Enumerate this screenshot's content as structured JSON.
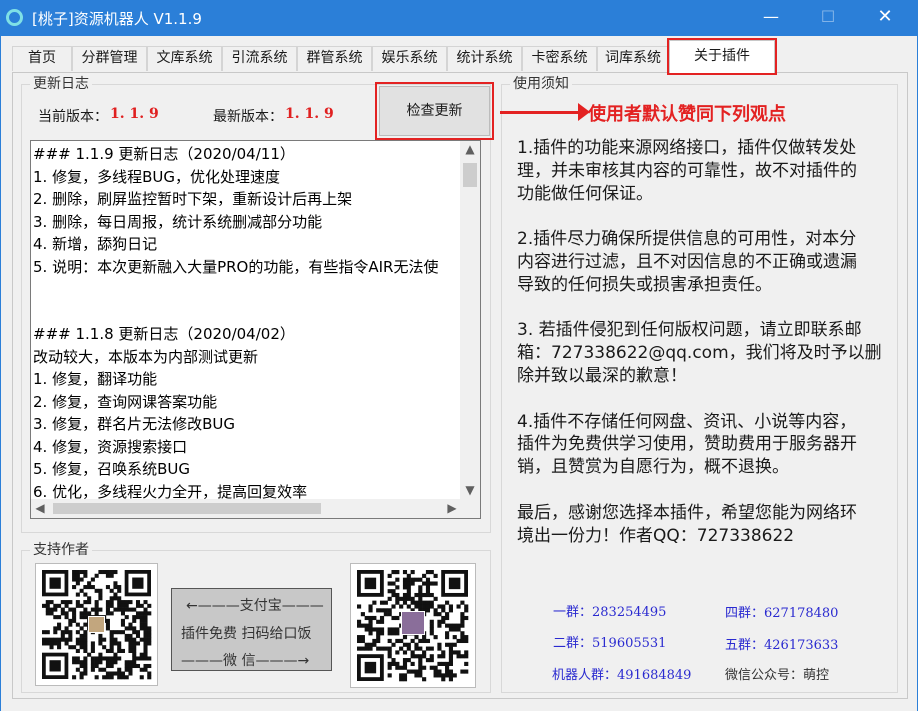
{
  "window": {
    "title": "[桃子]资源机器人 V1.1.9",
    "minimize_glyph": "—",
    "maximize_glyph": "☐",
    "close_glyph": "✕"
  },
  "tabs": [
    "首页",
    "分群管理",
    "文库系统",
    "引流系统",
    "群管系统",
    "娱乐系统",
    "统计系统",
    "卡密系统",
    "词库系统",
    "关于插件"
  ],
  "active_tab": "关于插件",
  "update_log": {
    "group_title": "更新日志",
    "current_label": "当前版本：",
    "current_version": "1. 1. 9",
    "latest_label": "最新版本：",
    "latest_version": "1. 1. 9",
    "check_button": "检查更新",
    "lines": [
      "### 1.1.9 更新日志（2020/04/11）",
      "1. 修复，多线程BUG，优化处理速度",
      "2. 删除，刷屏监控暂时下架，重新设计后再上架",
      "3. 删除，每日周报，统计系统删减部分功能",
      "4. 新增，舔狗日记",
      "5. 说明：本次更新融入大量PRO的功能，有些指令AIR无法使",
      "",
      "",
      "### 1.1.8 更新日志（2020/04/02）",
      "改动较大，本版本为内部测试更新",
      "1. 修复，翻译功能",
      "2. 修复，查询网课答案功能",
      "3. 修复，群名片无法修改BUG",
      "4. 修复，资源搜索接口",
      "5. 修复，召唤系统BUG",
      "6. 优化，多线程火力全开，提高回复效率"
    ]
  },
  "usage_notice": {
    "group_title": "使用须知",
    "annotation": "使用者默认赞同下列观点",
    "lines": [
      "1.插件的功能来源网络接口，插件仅做转发处",
      "理，并未审核其内容的可靠性，故不对插件的",
      "功能做任何保证。",
      "",
      "2.插件尽力确保所提供信息的可用性，对本分",
      "内容进行过滤，且不对因信息的不正确或遗漏",
      "导致的任何损失或损害承担责任。",
      "",
      "3. 若插件侵犯到任何版权问题，请立即联系邮",
      "箱：727338622@qq.com，我们将及时予以删",
      "除并致以最深的歉意！",
      "",
      "4.插件不存储任何网盘、资讯、小说等内容，",
      "插件为免费供学习使用，赞助费用于服务器开",
      "销，且赞赏为自愿行为，概不退换。",
      "",
      "最后，感谢您选择本插件，希望您能为网络环",
      "境出一份力！作者QQ：727338622"
    ]
  },
  "support": {
    "group_title": "支持作者",
    "alipay_line": "←———支付宝———",
    "middle_line": "插件免费  扫码给口饭",
    "wechat_line": "———微    信———→"
  },
  "qq_groups": [
    {
      "label": "一群：",
      "number": "283254495"
    },
    {
      "label": "四群：",
      "number": "627178480"
    },
    {
      "label": "二群：",
      "number": "519605531"
    },
    {
      "label": "五群：",
      "number": "426173633"
    },
    {
      "label": "机器人群：",
      "number": "491684849"
    }
  ],
  "wechat_account": "微信公众号：萌控",
  "colors": {
    "titlebar": "#2b7fd8",
    "highlight_red": "#e32222",
    "version_red": "#e02020",
    "group_blue": "#2a2ad0"
  }
}
